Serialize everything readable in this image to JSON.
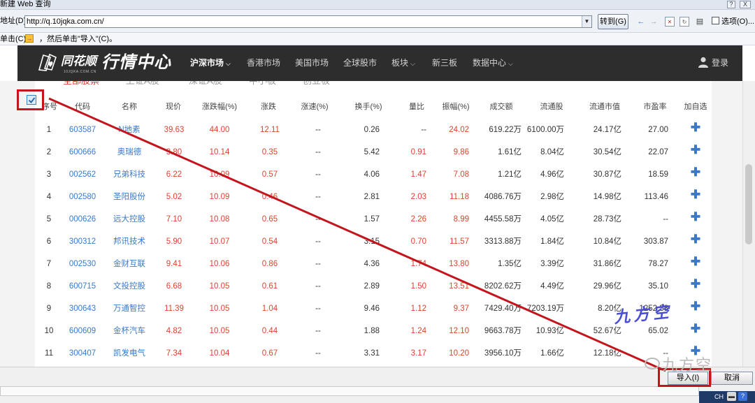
{
  "window": {
    "title": "新建 Web 查询",
    "help": "?",
    "close": "X"
  },
  "address": {
    "label": "地址(D):",
    "url": "http://q.10jqka.com.cn/",
    "go_label": "转到(G)",
    "options_label": "选项(O)..."
  },
  "hint": {
    "part1": "单击(C)",
    "part2": "，然后单击\"导入\"(C)。"
  },
  "site": {
    "logo_text": "同花顺",
    "logo_sub": "10JQKA.COM.CN",
    "title": "行情中心",
    "nav": [
      "沪深市场",
      "香港市场",
      "美国市场",
      "全球股市",
      "板块",
      "新三板",
      "数据中心"
    ],
    "login": "登录"
  },
  "subtabs": [
    "全部股票",
    "上证A股",
    "深证A股",
    "中小板",
    "创业板"
  ],
  "table": {
    "headers": [
      "序号",
      "代码",
      "名称",
      "现价",
      "涨跌幅(%)",
      "涨跌",
      "涨速(%)",
      "换手(%)",
      "量比",
      "振幅(%)",
      "成交额",
      "流通股",
      "流通市值",
      "市盈率",
      "加自选"
    ],
    "rows": [
      [
        "1",
        "603587",
        "N地素",
        "39.63",
        "44.00",
        "12.11",
        "--",
        "0.26",
        "--",
        "24.02",
        "619.22万",
        "6100.00万",
        "24.17亿",
        "27.00"
      ],
      [
        "2",
        "600666",
        "奥瑞德",
        "3.80",
        "10.14",
        "0.35",
        "--",
        "5.42",
        "0.91",
        "9.86",
        "1.61亿",
        "8.04亿",
        "30.54亿",
        "22.07"
      ],
      [
        "3",
        "002562",
        "兄弟科技",
        "6.22",
        "10.09",
        "0.57",
        "--",
        "4.06",
        "1.47",
        "7.08",
        "1.21亿",
        "4.96亿",
        "30.87亿",
        "18.59"
      ],
      [
        "4",
        "002580",
        "圣阳股份",
        "5.02",
        "10.09",
        "0.46",
        "--",
        "2.81",
        "2.03",
        "11.18",
        "4086.76万",
        "2.98亿",
        "14.98亿",
        "113.46"
      ],
      [
        "5",
        "000626",
        "远大控股",
        "7.10",
        "10.08",
        "0.65",
        "--",
        "1.57",
        "2.26",
        "8.99",
        "4455.58万",
        "4.05亿",
        "28.73亿",
        "--"
      ],
      [
        "6",
        "300312",
        "邦讯技术",
        "5.90",
        "10.07",
        "0.54",
        "--",
        "3.15",
        "0.70",
        "11.57",
        "3313.88万",
        "1.84亿",
        "10.84亿",
        "303.87"
      ],
      [
        "7",
        "002530",
        "金财互联",
        "9.41",
        "10.06",
        "0.86",
        "--",
        "4.36",
        "1.74",
        "13.80",
        "1.35亿",
        "3.39亿",
        "31.86亿",
        "78.27"
      ],
      [
        "8",
        "600715",
        "文投控股",
        "6.68",
        "10.05",
        "0.61",
        "--",
        "2.89",
        "1.50",
        "13.51",
        "8202.62万",
        "4.49亿",
        "29.96亿",
        "35.10"
      ],
      [
        "9",
        "300643",
        "万通智控",
        "11.39",
        "10.05",
        "1.04",
        "--",
        "9.46",
        "1.12",
        "9.37",
        "7429.40万",
        "7203.19万",
        "8.20亿",
        "1252.38"
      ],
      [
        "10",
        "600609",
        "金杯汽车",
        "4.82",
        "10.05",
        "0.44",
        "--",
        "1.88",
        "1.24",
        "12.10",
        "9663.78万",
        "10.93亿",
        "52.67亿",
        "65.02"
      ],
      [
        "11",
        "300407",
        "凯发电气",
        "7.34",
        "10.04",
        "0.67",
        "--",
        "3.31",
        "3.17",
        "10.20",
        "3956.10万",
        "1.66亿",
        "12.18亿",
        "--"
      ]
    ],
    "add_icon": "plus-icon",
    "add_glyph": "✚"
  },
  "dialog": {
    "ok_label": "导入(I)",
    "cancel_label": "取消"
  },
  "tray": {
    "text": "CH"
  },
  "watermark": {
    "text": "九方空"
  },
  "wechat_watermark": {
    "text": "九方空"
  },
  "colors": {
    "up": "#d9442f",
    "code": "#3a7ac8",
    "nav_bg": "#2d2d2d",
    "annotation": "#c4151c",
    "tab_active": "#e23a2a"
  }
}
